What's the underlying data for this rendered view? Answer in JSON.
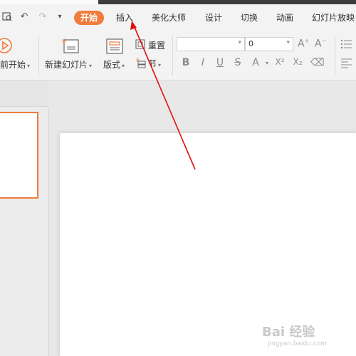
{
  "tabs": [
    {
      "label": "开始",
      "active": true
    },
    {
      "label": "插入"
    },
    {
      "label": "美化大师"
    },
    {
      "label": "设计"
    },
    {
      "label": "切换"
    },
    {
      "label": "动画"
    },
    {
      "label": "幻灯片放映"
    }
  ],
  "ribbon": {
    "play_label": "前开始",
    "new_slide_label": "新建幻灯片",
    "layout_label": "版式",
    "reset_label": "重置",
    "section_label": "节",
    "font_size_value": "0",
    "font_name_value": ""
  },
  "format_buttons": [
    "B",
    "I",
    "U",
    "S",
    "A",
    "X²",
    "X₂",
    "⌫"
  ],
  "watermark": {
    "text": "Bai 经验",
    "url": "jingyan.baidu.com"
  },
  "accent_color": "#f07c3d"
}
